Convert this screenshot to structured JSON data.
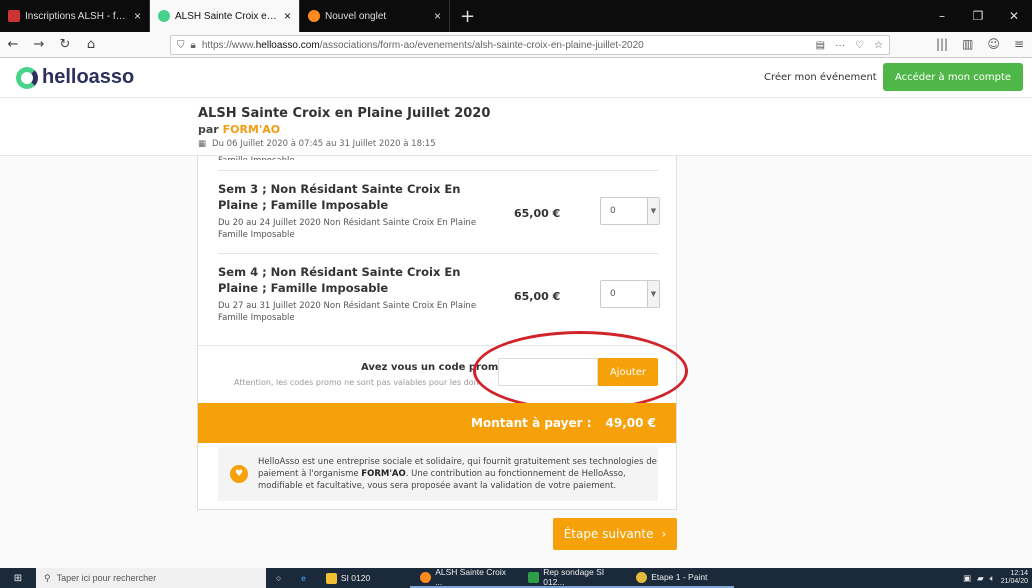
{
  "browser": {
    "tabs": [
      {
        "title": "Inscriptions ALSH - formao.co",
        "color": "#c33"
      },
      {
        "title": "ALSH Sainte Croix en Plaine Ju",
        "color": "#49d38a"
      },
      {
        "title": "Nouvel onglet",
        "color": "#ff8a1e"
      }
    ],
    "url_prefix": "https://www.",
    "url_domain": "helloasso.com",
    "url_path": "/associations/form-ao/evenements/alsh-sainte-croix-en-plaine-juillet-2020"
  },
  "site": {
    "logo": "helloasso",
    "create_event": "Créer mon événement",
    "account_button": "Accéder à mon compte"
  },
  "event": {
    "title": "ALSH Sainte Croix en Plaine Juillet 2020",
    "by": "par",
    "organizer": "FORM'AO",
    "date": "Du 06 Juillet 2020 à 07:45 au 31 Juillet 2020 à 18:15",
    "clipped_text": "Famille Imposable"
  },
  "items": [
    {
      "name": "Sem 3 ; Non Résidant Sainte Croix En Plaine ; Famille Imposable",
      "description": "Du 20 au 24 Juillet 2020 Non Résidant Sainte Croix En Plaine Famille Imposable",
      "price": "65,00 €",
      "qty": "0"
    },
    {
      "name": "Sem 4 ; Non Résidant Sainte Croix En Plaine ; Famille Imposable",
      "description": "Du 27 au 31 Juillet 2020 Non Résidant Sainte Croix En Plaine Famille Imposable",
      "price": "65,00 €",
      "qty": "0"
    }
  ],
  "promo": {
    "question": "Avez vous un code promo",
    "note": "Attention, les codes promo ne sont pas valables pour les don",
    "input_value": "",
    "button": "Ajouter"
  },
  "total": {
    "label": "Montant à payer :",
    "amount": "49,00 €"
  },
  "info": {
    "text_before": "HelloAsso est une entreprise sociale et solidaire, qui fournit gratuitement ses technologies de paiement à l'organisme ",
    "org": "FORM'AO",
    "text_after": ". Une contribution au fonctionnement de HelloAsso, modifiable et facultative, vous sera proposée avant la validation de votre paiement."
  },
  "next_button": "Étape suivante",
  "taskbar": {
    "search": "Taper ici pour rechercher",
    "items": [
      {
        "label": "SI 0120",
        "color": "#f0c030"
      },
      {
        "label": "ALSH Sainte Croix ...",
        "color": "#ff8a1e"
      },
      {
        "label": "Rep sondage SI 012...",
        "color": "#2e9e48"
      },
      {
        "label": "Etape 1 - Paint",
        "color": "#e5b93a"
      }
    ],
    "time": "12:14",
    "date": "21/04/20"
  },
  "colors": {
    "accent": "#f7a10a",
    "brand_green": "#4fb748",
    "annotation_red": "#d0232a"
  }
}
